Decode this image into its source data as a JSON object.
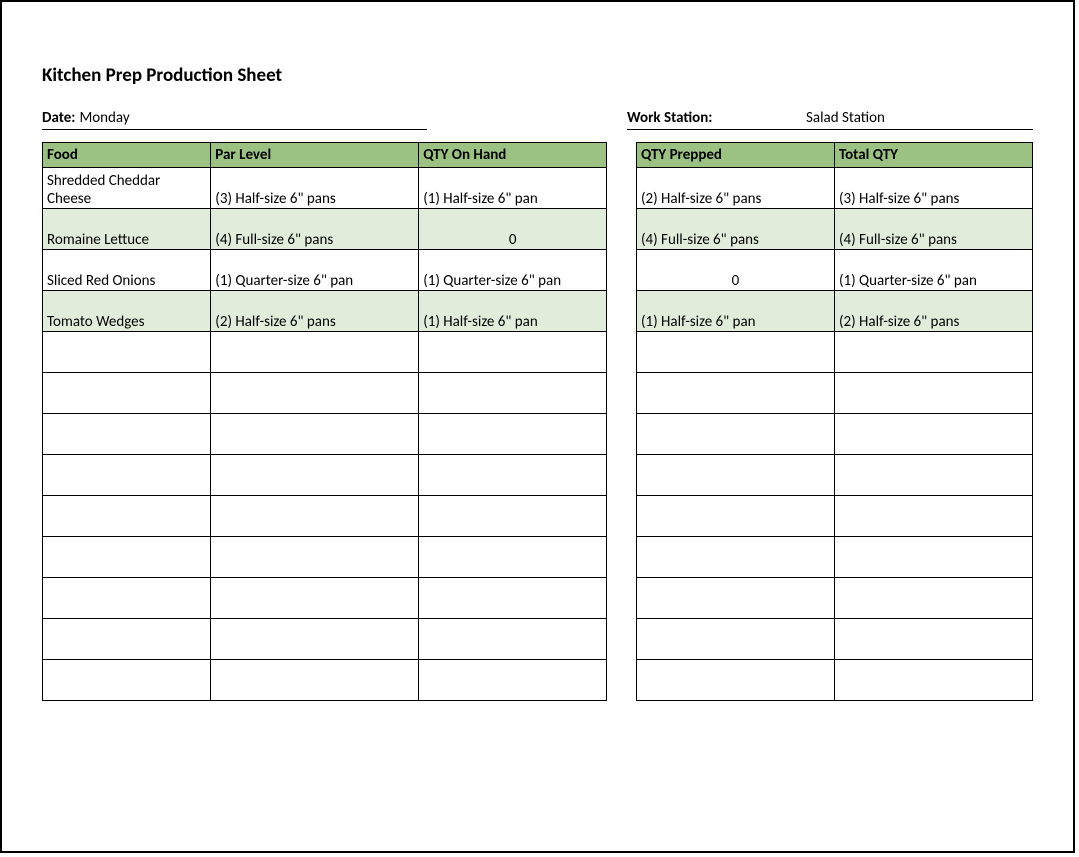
{
  "title": "Kitchen Prep Production Sheet",
  "meta": {
    "date_label": "Date:",
    "date_value": "Monday",
    "workstation_label": "Work Station:",
    "workstation_value": "Salad Station"
  },
  "headers": {
    "food": "Food",
    "par": "Par Level",
    "onhand": "QTY On Hand",
    "prepped": "QTY Prepped",
    "total": "Total QTY"
  },
  "rows": [
    {
      "food": "Shredded Cheddar Cheese",
      "par": "(3) Half-size 6\" pans",
      "onhand": "(1) Half-size 6\" pan",
      "onhand_align": "left",
      "prepped": "(2) Half-size 6\" pans",
      "prepped_align": "left",
      "total": "(3) Half-size 6\" pans",
      "alt": false,
      "tall": true
    },
    {
      "food": "Romaine Lettuce",
      "par": "(4) Full-size 6\" pans",
      "onhand": "0",
      "onhand_align": "center",
      "prepped": "(4) Full-size 6\" pans",
      "prepped_align": "left",
      "total": "(4) Full-size 6\" pans",
      "alt": true,
      "tall": false
    },
    {
      "food": "Sliced Red Onions",
      "par": "(1) Quarter-size 6\" pan",
      "onhand": "(1) Quarter-size 6\" pan",
      "onhand_align": "left",
      "prepped": "0",
      "prepped_align": "center",
      "total": "(1) Quarter-size 6\" pan",
      "alt": false,
      "tall": false
    },
    {
      "food": "Tomato Wedges",
      "par": "(2) Half-size 6\" pans",
      "onhand": "(1) Half-size 6\" pan",
      "onhand_align": "left",
      "prepped": "(1) Half-size 6\" pan",
      "prepped_align": "left",
      "total": "(2) Half-size 6\" pans",
      "alt": true,
      "tall": false
    }
  ],
  "empty_row_count": 9
}
